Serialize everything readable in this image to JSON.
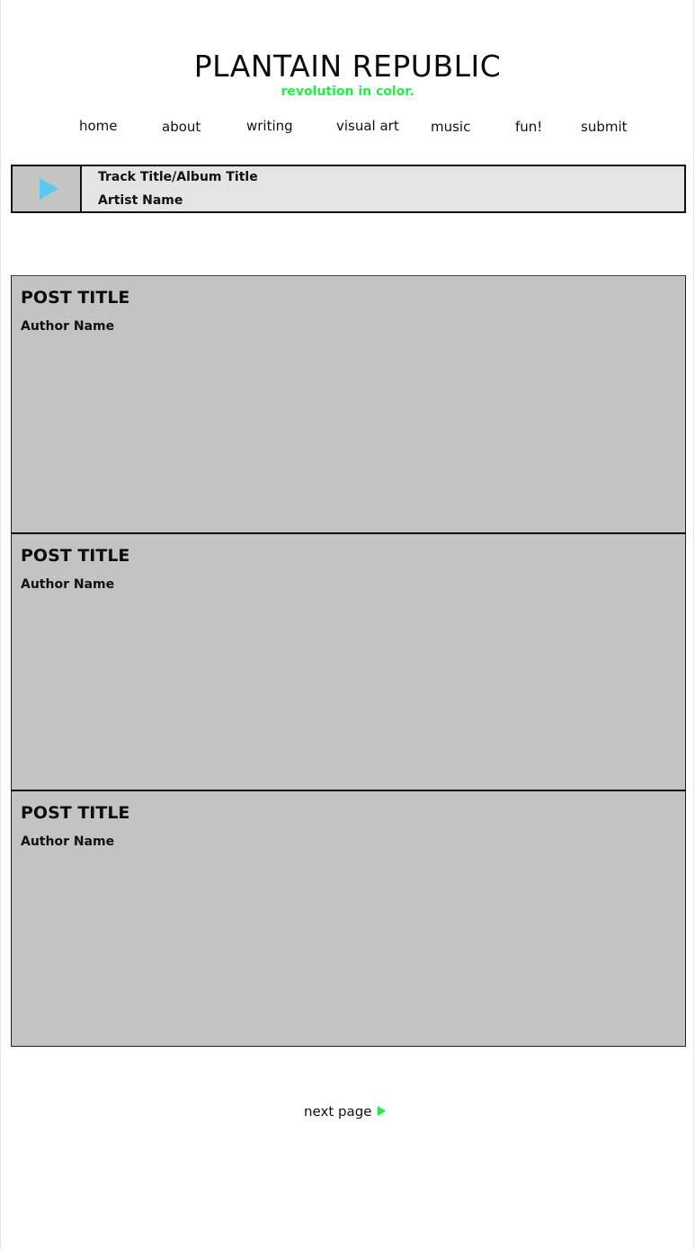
{
  "site": {
    "title": "PLANTAIN REPUBLIC",
    "tagline": "revolution in color."
  },
  "nav": {
    "items": [
      {
        "label": "home"
      },
      {
        "label": "about"
      },
      {
        "label": "writing"
      },
      {
        "label": "visual art"
      },
      {
        "label": "music"
      },
      {
        "label": "fun!"
      },
      {
        "label": "submit"
      }
    ]
  },
  "player": {
    "play_icon": "play-icon",
    "track_title": "Track Title/Album Title",
    "artist": "Artist Name"
  },
  "posts": [
    {
      "title": "POST TITLE",
      "author": "Author Name"
    },
    {
      "title": "POST TITLE",
      "author": "Author Name"
    },
    {
      "title": "POST TITLE",
      "author": "Author Name"
    }
  ],
  "pagination": {
    "next_label": "next page",
    "next_icon": "arrow-right-icon"
  },
  "colors": {
    "accent": "#22ee44",
    "play_icon": "#5bc8f0",
    "post_background": "#c3c3c3",
    "player_background": "#e4e4e4"
  }
}
